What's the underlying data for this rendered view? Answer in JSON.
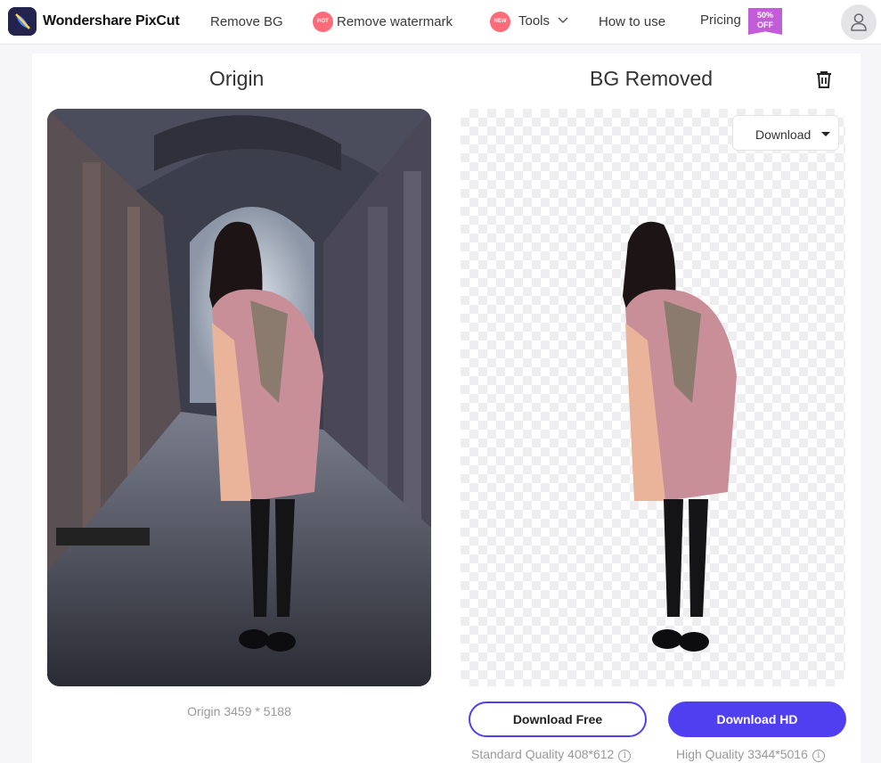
{
  "nav": {
    "brand": "Wondershare PixCut",
    "items": [
      {
        "label": "Remove BG"
      },
      {
        "label": "Remove watermark",
        "badge": "HOT"
      },
      {
        "label": "Tools",
        "badge": "NEW"
      },
      {
        "label": "How to use"
      },
      {
        "label": "Pricing",
        "badge_line1": "50%",
        "badge_line2": "OFF"
      }
    ],
    "icons": {
      "logo": "pixcut-logo-icon",
      "chevron": "chevron-down-icon",
      "avatar": "user-icon"
    }
  },
  "origin": {
    "title": "Origin",
    "size_text": "Origin 3459 * 5188"
  },
  "removed": {
    "title": "BG Removed",
    "download_dropdown": "Download",
    "delete_icon": "trash-icon"
  },
  "actions": {
    "download_free": "Download Free",
    "download_hd": "Download HD",
    "standard_quality": "Standard Quality 408*612",
    "high_quality": "High Quality 3344*5016",
    "info_glyph": "i"
  },
  "colors": {
    "accent": "#4f3ff0",
    "hot": "#ff6b78",
    "sale": "#c25cd8"
  }
}
